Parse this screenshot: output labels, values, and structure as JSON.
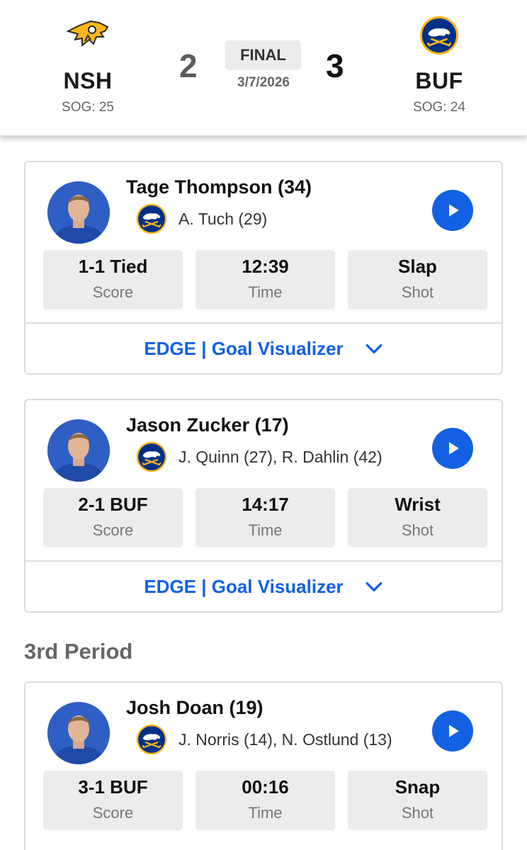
{
  "game": {
    "home": {
      "abbr": "NSH",
      "score": "2",
      "sog": "SOG: 25"
    },
    "away": {
      "abbr": "BUF",
      "score": "3",
      "sog": "SOG: 24"
    },
    "status": "FINAL",
    "date": "3/7/2026"
  },
  "colors": {
    "accent": "#1360e3",
    "sabres_blue": "#003087",
    "sabres_gold": "#FFB81C",
    "predators_gold": "#FFB81C"
  },
  "goals": [
    {
      "scorer": "Tage Thompson (34)",
      "assists": "A. Tuch (29)",
      "team_logo": "sabres-logo",
      "stats": [
        {
          "value": "1-1 Tied",
          "label": "Score"
        },
        {
          "value": "12:39",
          "label": "Time"
        },
        {
          "value": "Slap",
          "label": "Shot"
        }
      ],
      "footer": "EDGE | Goal Visualizer"
    },
    {
      "scorer": "Jason Zucker (17)",
      "assists": "J. Quinn (27), R. Dahlin (42)",
      "team_logo": "sabres-logo",
      "stats": [
        {
          "value": "2-1 BUF",
          "label": "Score"
        },
        {
          "value": "14:17",
          "label": "Time"
        },
        {
          "value": "Wrist",
          "label": "Shot"
        }
      ],
      "footer": "EDGE | Goal Visualizer"
    },
    {
      "scorer": "Josh Doan (19)",
      "assists": "J. Norris (14), N. Ostlund (13)",
      "team_logo": "sabres-logo",
      "stats": [
        {
          "value": "3-1 BUF",
          "label": "Score"
        },
        {
          "value": "00:16",
          "label": "Time"
        },
        {
          "value": "Snap",
          "label": "Shot"
        }
      ]
    }
  ],
  "sections": {
    "third_period": "3rd Period"
  }
}
